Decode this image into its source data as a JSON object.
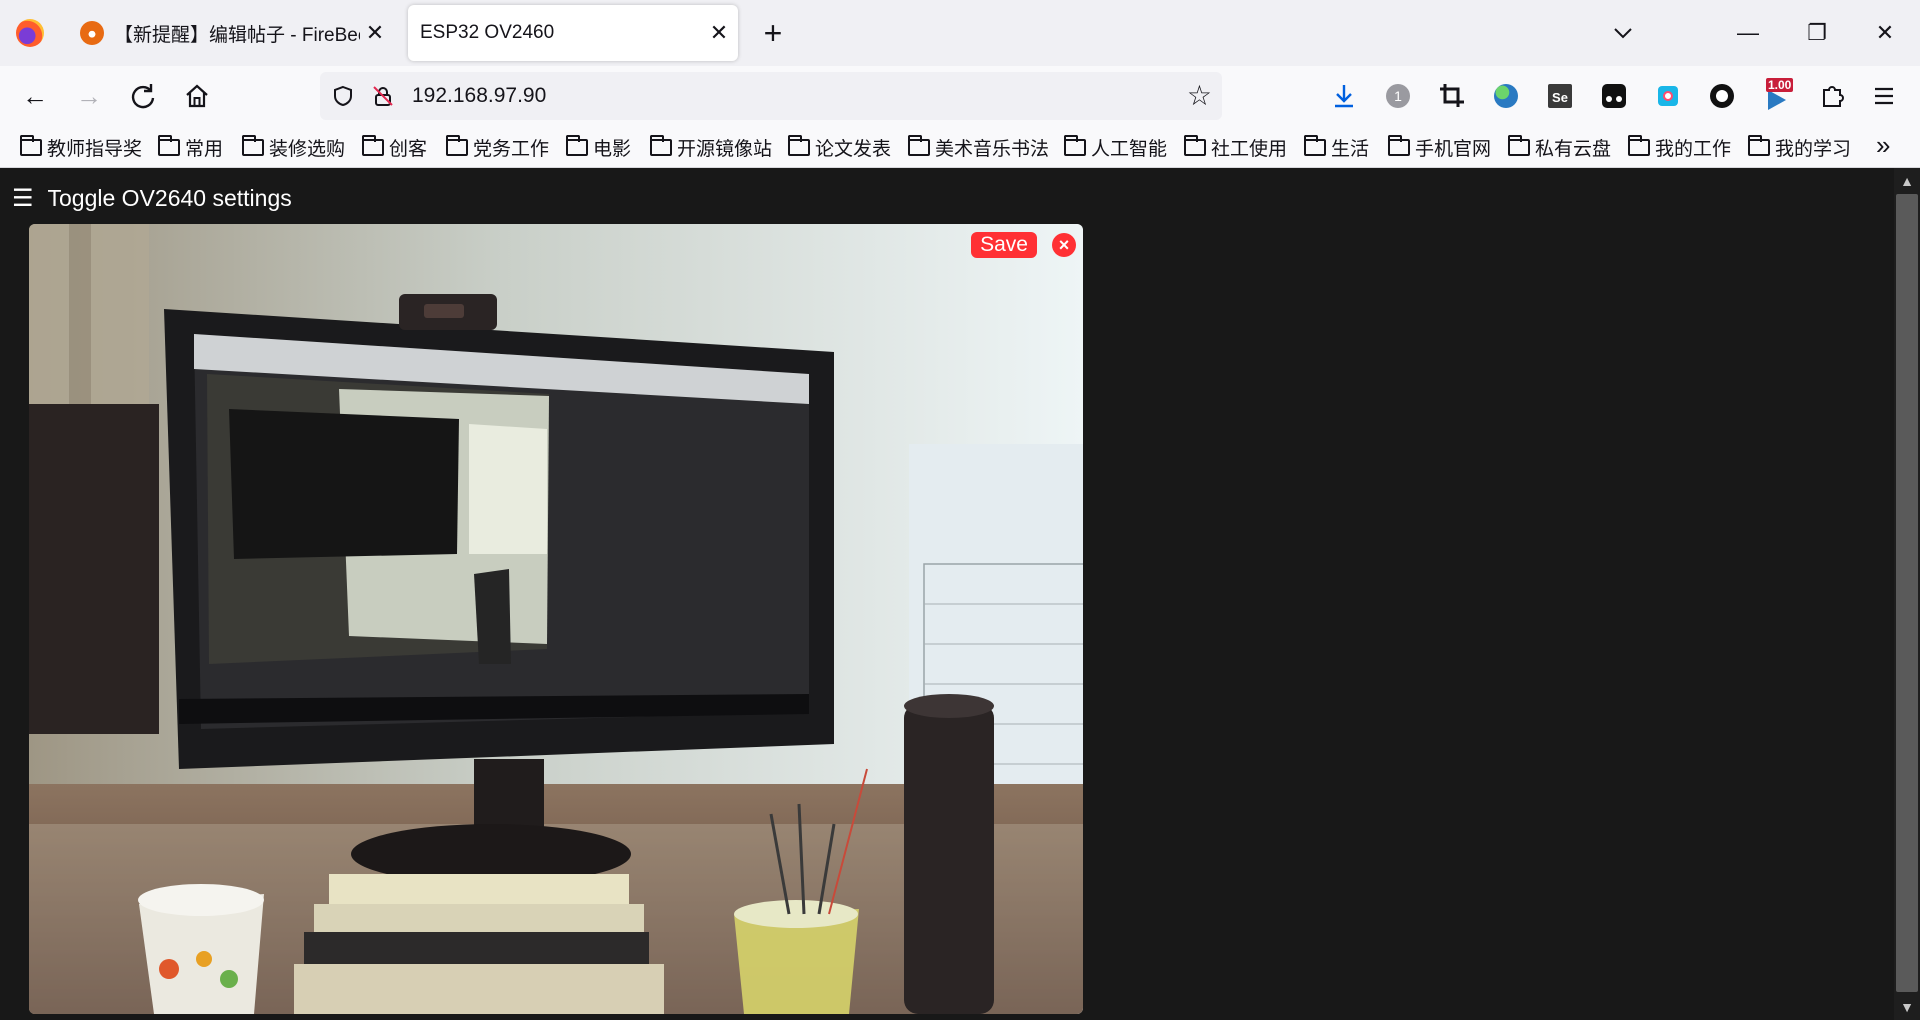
{
  "browser": {
    "tabs": [
      {
        "title": "【新提醒】编辑帖子 - FireBeetle"
      },
      {
        "title": "ESP32 OV2460"
      }
    ],
    "new_tab_label": "+",
    "close_label": "✕",
    "window": {
      "minimize": "—",
      "restore": "❐",
      "close": "✕"
    }
  },
  "urlbar": {
    "url": "192.168.97.90"
  },
  "extensions": {
    "badge_count": "1",
    "se_label": "Se",
    "speed_badge": "1.00"
  },
  "bookmarks": [
    "教师指导奖",
    "常用",
    "装修选购",
    "创客",
    "党务工作",
    "电影",
    "开源镜像站",
    "论文发表",
    "美术音乐书法",
    "人工智能",
    "社工使用",
    "生活",
    "手机官网",
    "私有云盘",
    "我的工作",
    "我的学习"
  ],
  "page": {
    "toggle_label": "Toggle OV2640 settings",
    "save_label": "Save",
    "close_label": "×",
    "menu_glyph": "☰",
    "colors": {
      "background": "#181818",
      "accent": "#ff3034"
    }
  }
}
